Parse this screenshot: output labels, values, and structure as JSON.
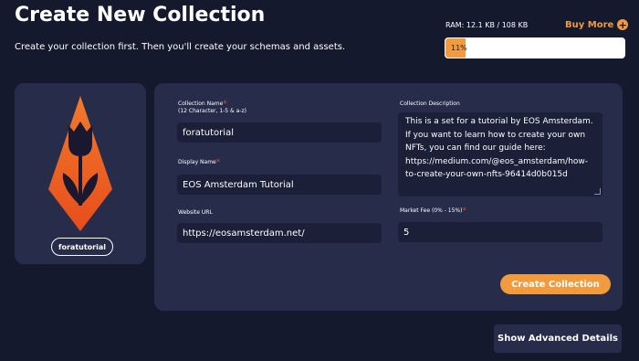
{
  "header": {
    "title": "Create New Collection",
    "subtitle": "Create your collection first. Then you'll create your schemas and assets."
  },
  "ram": {
    "label": "RAM: 12.1 KB / 108 KB",
    "buy_more": "Buy More",
    "percent_label": "11%",
    "percent": 11
  },
  "logo_card": {
    "collection_name": "foratutorial",
    "logo_icon": "tulip-logo-icon"
  },
  "form": {
    "collection_name": {
      "label": "Collection Name",
      "hint": "(12 Character, 1-5 & a-z)",
      "value": "foratutorial",
      "required": "*"
    },
    "display_name": {
      "label": "Display Name",
      "value": "EOS Amsterdam Tutorial",
      "required": "*"
    },
    "website_url": {
      "label": "Website URL",
      "value": "https://eosamsterdam.net/"
    },
    "collection_description": {
      "label": "Collection Description",
      "lines": [
        "This is a set for a tutorial by EOS Amsterdam.",
        "If you want to learn how to create your own",
        "NFTs, you can find our guide here:",
        "https://medium.com/@eos_amsterdam/how-",
        "to-create-your-own-nfts-96414d0b015d"
      ]
    },
    "market_fee": {
      "label": "Market Fee (0% - 15%)",
      "value": "5",
      "required": "*"
    },
    "create_button": "Create Collection"
  },
  "advanced_button": "Show Advanced Details",
  "colors": {
    "background": "#15192e",
    "card": "#272c4a",
    "input": "#1b1f37",
    "accent": "#f19a3e",
    "required": "#e0443a"
  }
}
